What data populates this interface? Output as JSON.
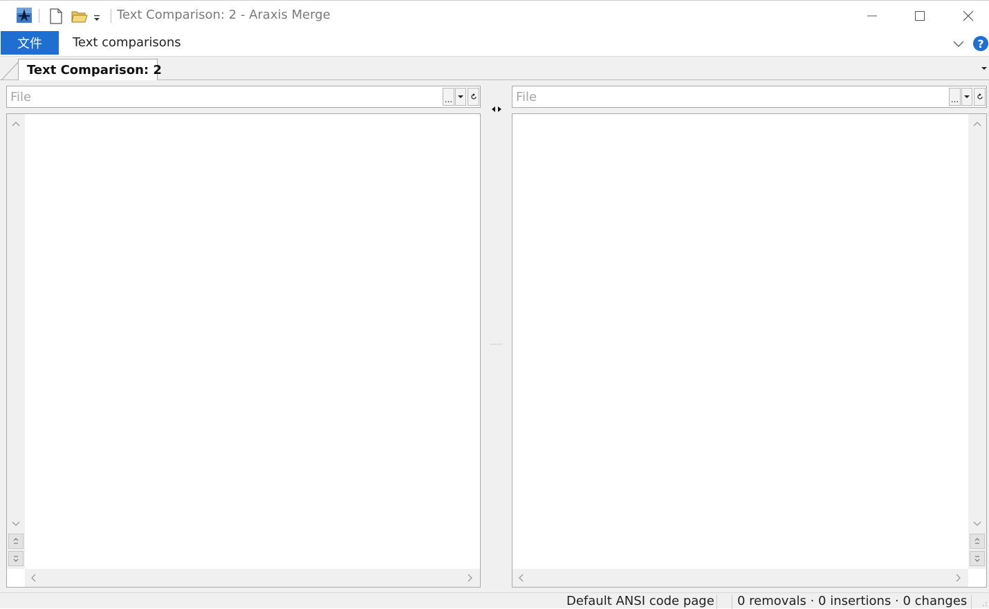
{
  "titlebar": {
    "title": "Text Comparison: 2 - Araxis Merge",
    "icons": [
      "araxis-merge-app-icon",
      "new-document-icon",
      "open-folder-icon",
      "customize-dropdown-icon",
      "minimize-icon",
      "maximize-icon",
      "close-icon"
    ]
  },
  "ribbon": {
    "file_tab": "文件",
    "tabs": [
      {
        "label": "Text comparisons"
      }
    ],
    "help_label": "?"
  },
  "document_tabs": [
    {
      "label": "Text Comparison: 2",
      "active": true
    }
  ],
  "left_pane": {
    "file_value": "",
    "file_placeholder": "File",
    "browse_label": "...",
    "drop_label": "▾",
    "refresh_label": "⟳"
  },
  "right_pane": {
    "file_value": "",
    "file_placeholder": "File",
    "browse_label": "...",
    "drop_label": "▾",
    "refresh_label": "⟳"
  },
  "statusbar": {
    "encoding": "Default ANSI code page",
    "counts": "0 removals · 0 insertions · 0 changes"
  },
  "colors": {
    "accent": "#1e6fd0",
    "help": "#1f6fd6",
    "chrome": "#f0f0f0",
    "border": "#a8a8a8"
  }
}
